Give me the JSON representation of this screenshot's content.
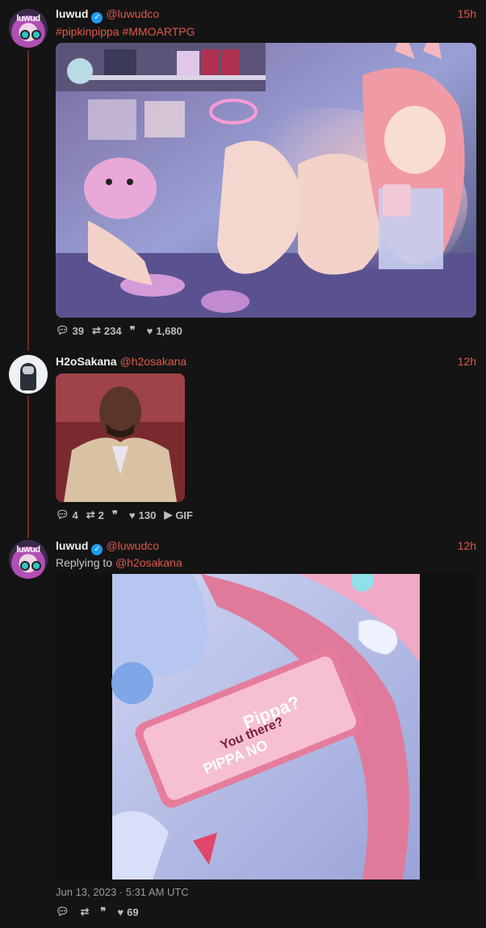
{
  "tweets": [
    {
      "name": "luwud",
      "handle": "@luwudco",
      "time": "15h",
      "tags": "#pipkinpippa #MMOARTPG",
      "stats": {
        "replies": "39",
        "retweets": "234",
        "quotes": "",
        "likes": "1,680"
      }
    },
    {
      "name": "H2oSakana",
      "handle": "@h2osakana",
      "time": "12h",
      "stats": {
        "replies": "4",
        "retweets": "2",
        "quotes": "",
        "likes": "130",
        "gif": "GIF"
      }
    },
    {
      "name": "luwud",
      "handle": "@luwudco",
      "time": "12h",
      "replying_prefix": "Replying to",
      "replying_to": "@h2osakana",
      "date": "Jun 13, 2023 · 5:31 AM UTC",
      "phone_text": [
        "Pippa?",
        "You there?",
        "PIPPA NO"
      ],
      "stats": {
        "replies": "",
        "retweets": "",
        "quotes": "",
        "likes": "69"
      }
    }
  ],
  "avatar_label": "luwud",
  "icons": {
    "reply": "comment-icon",
    "retweet": "retweet-icon",
    "quote": "quote-icon",
    "like": "heart-icon",
    "play": "play-icon"
  },
  "colors": {
    "accent": "#e0584b",
    "background": "#141414",
    "thread_line": "#6b2a26"
  }
}
